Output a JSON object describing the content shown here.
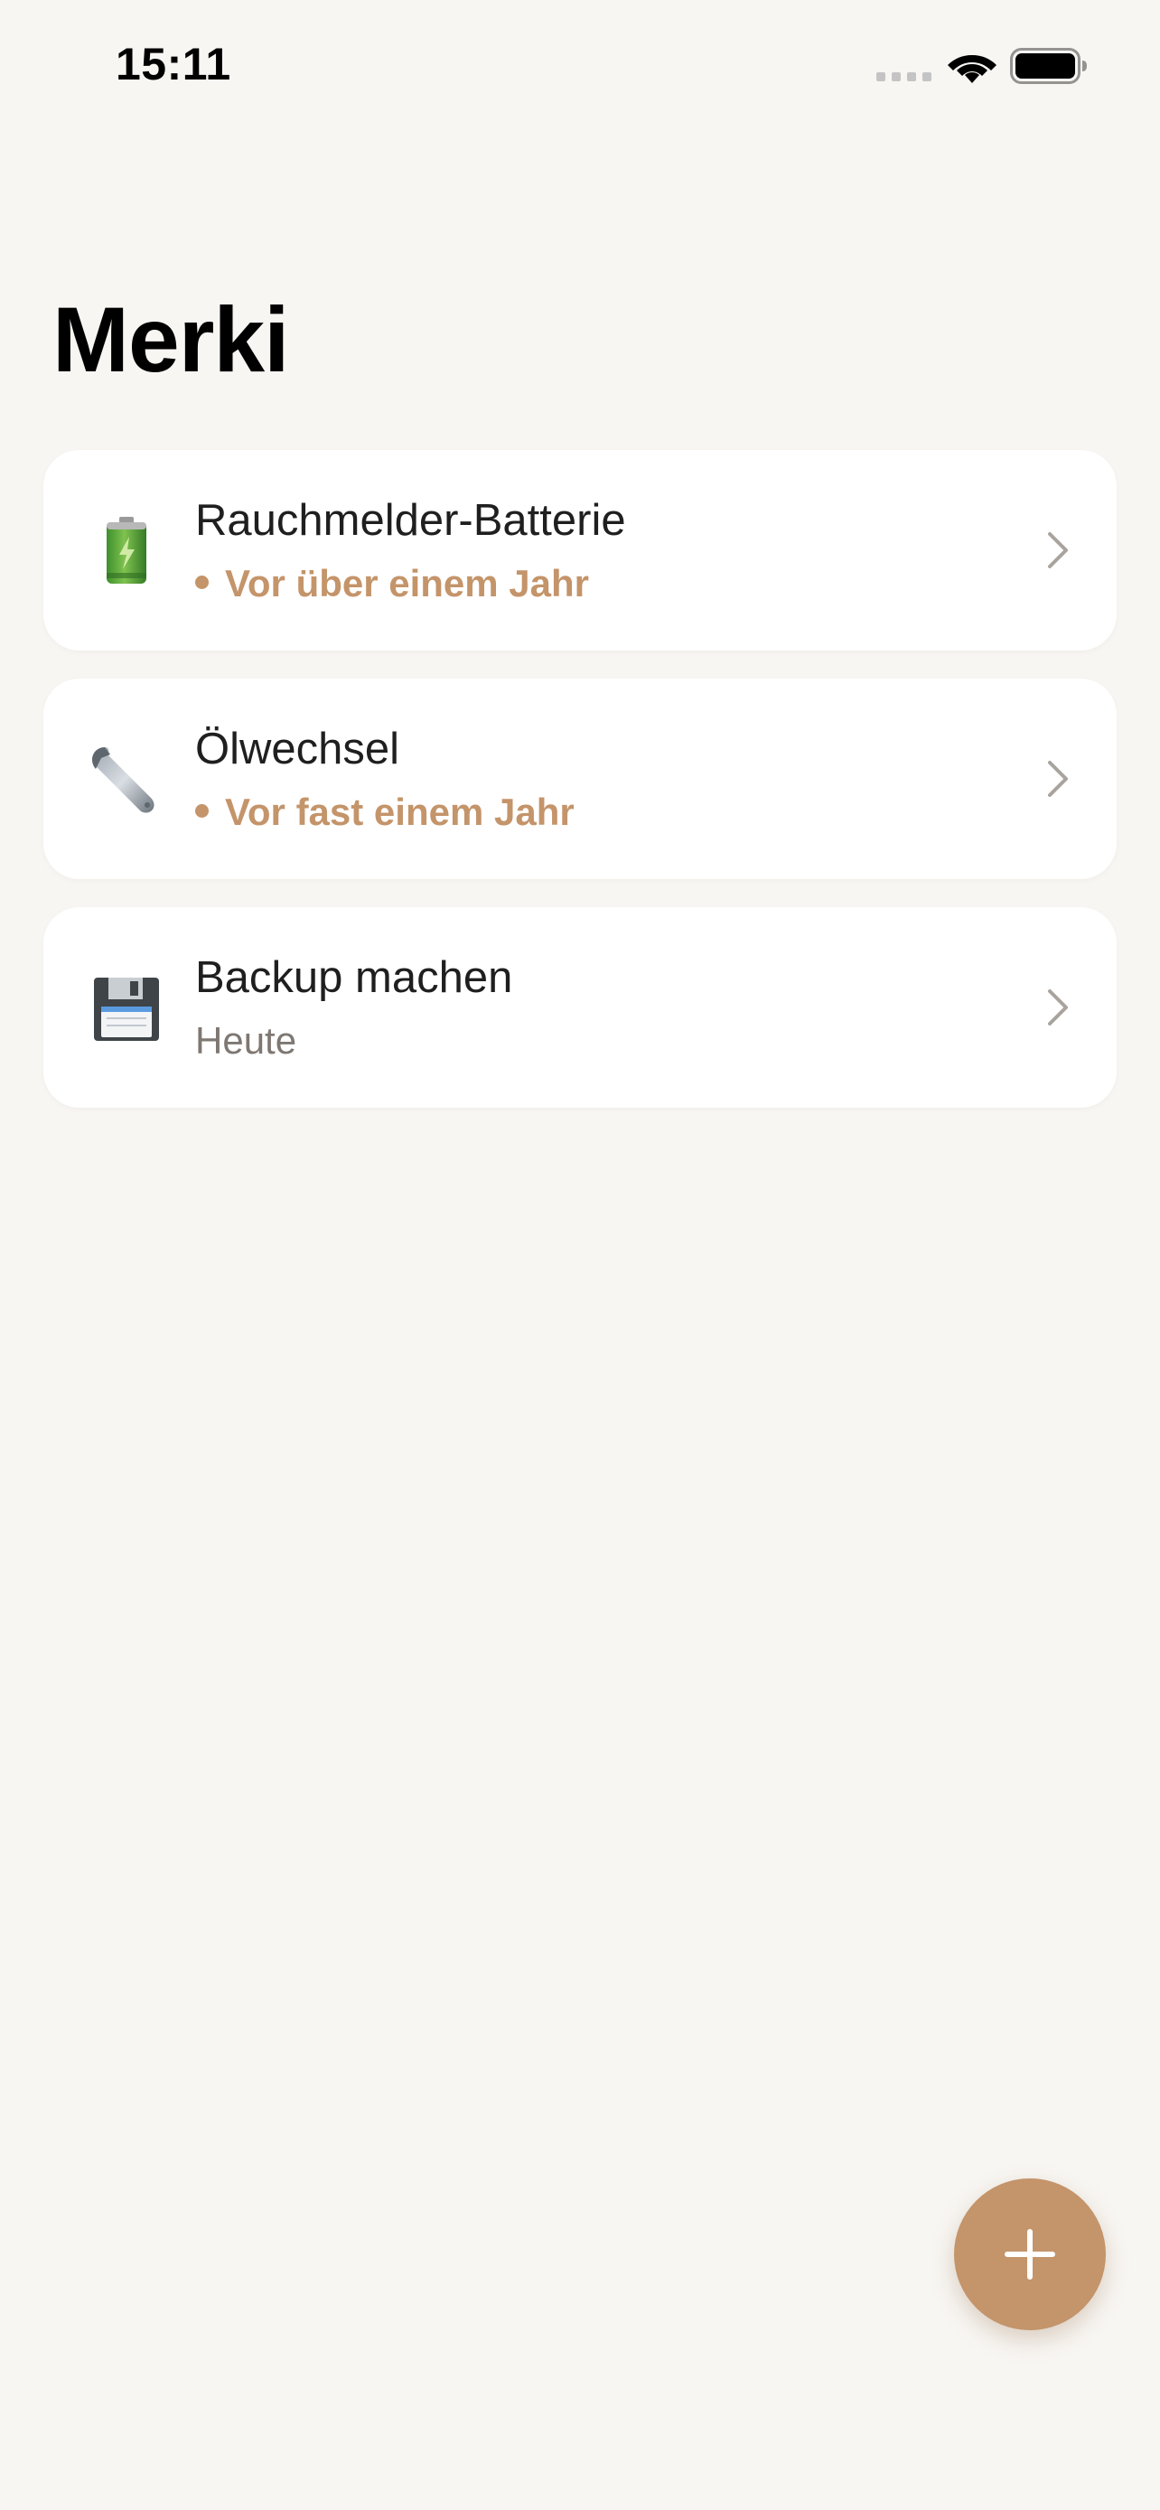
{
  "status_bar": {
    "time": "15:11",
    "signal_icon": "cellular-signal-icon",
    "wifi_icon": "wifi-icon",
    "battery_icon": "battery-full-icon"
  },
  "header": {
    "title": "Merki"
  },
  "reminders": [
    {
      "icon": "battery-icon",
      "title": "Rauchmelder-Batterie",
      "subtitle": "Vor über einem Jahr",
      "overdue": true
    },
    {
      "icon": "wrench-icon",
      "title": "Ölwechsel",
      "subtitle": "Vor fast einem Jahr",
      "overdue": true
    },
    {
      "icon": "floppy-disk-icon",
      "title": "Backup machen",
      "subtitle": "Heute",
      "overdue": false
    }
  ],
  "fab": {
    "icon": "plus-icon"
  },
  "colors": {
    "background": "#f8f6f3",
    "card": "#ffffff",
    "accent": "#c4946a",
    "secondary_text": "#7e7772"
  }
}
